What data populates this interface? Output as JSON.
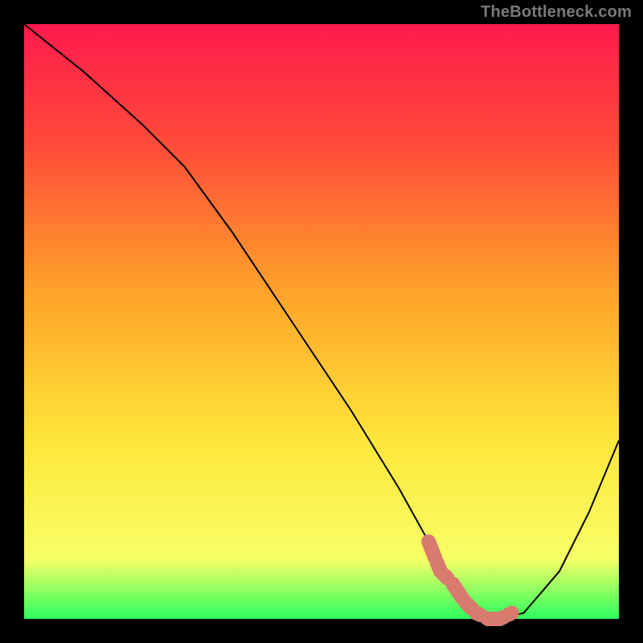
{
  "attribution": "TheBottleneck.com",
  "chart_data": {
    "type": "line",
    "title": "",
    "xlabel": "",
    "ylabel": "",
    "xlim": [
      0,
      100
    ],
    "ylim": [
      0,
      100
    ],
    "grid": false,
    "background_gradient": {
      "top_color": "#ff1a4d",
      "mid_color": "#ffd200",
      "bottom_color": "#2cff5e"
    },
    "series": [
      {
        "name": "bottleneck-curve",
        "color": "#000000",
        "width": 2,
        "x": [
          0,
          10,
          20,
          27,
          35,
          45,
          55,
          63,
          68,
          72,
          76,
          80,
          84,
          90,
          95,
          100
        ],
        "y": [
          100,
          92,
          83,
          76,
          65,
          50,
          35,
          22,
          13,
          6,
          1,
          0,
          1,
          8,
          18,
          30
        ]
      },
      {
        "name": "recommended-range",
        "color": "#d87a6e",
        "type": "marker-band",
        "x": [
          68,
          70,
          72,
          74,
          76,
          78,
          80,
          82
        ],
        "y": [
          13,
          8,
          6,
          3,
          1,
          0,
          0,
          1
        ]
      }
    ],
    "optimal_point": {
      "x": 80,
      "y": 0
    }
  }
}
